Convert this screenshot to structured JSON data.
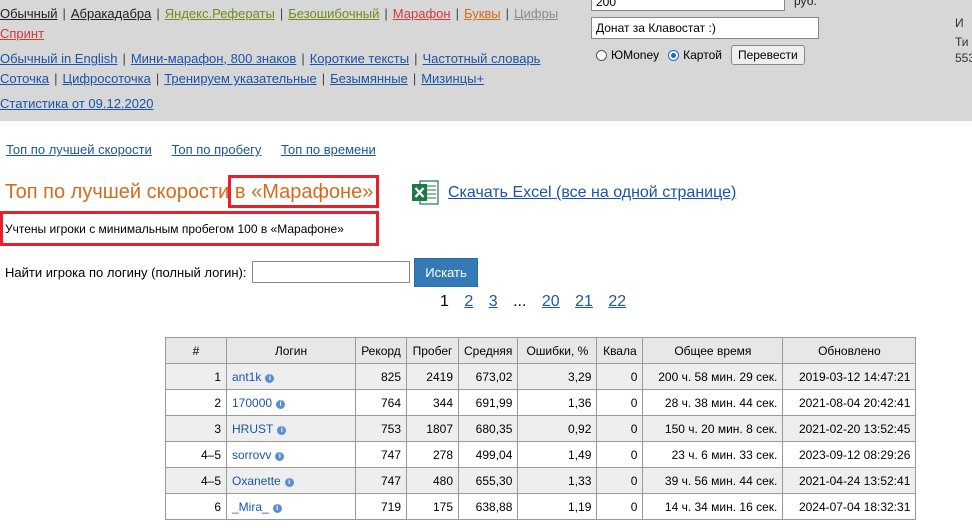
{
  "header": {
    "nav_row1": [
      {
        "label": "Обычный",
        "color": "gray"
      },
      {
        "label": "Абракадабра",
        "color": "gray"
      },
      {
        "label": "Яндекс.Рефераты",
        "color": "green"
      },
      {
        "label": "Безошибочный",
        "color": "green"
      },
      {
        "label": "Марафон",
        "color": "red"
      },
      {
        "label": "Буквы",
        "color": "orange"
      },
      {
        "label": "Цифры",
        "color": "lightgray"
      }
    ],
    "nav_row1b": [
      {
        "label": "Спринт",
        "color": "red"
      }
    ],
    "nav_row2": [
      {
        "label": "Обычный in English",
        "color": "blue"
      },
      {
        "label": "Мини-марафон, 800 знаков",
        "color": "blue"
      },
      {
        "label": "Короткие тексты",
        "color": "blue"
      },
      {
        "label": "Частотный словарь",
        "color": "blue"
      }
    ],
    "nav_row3": [
      {
        "label": "Соточка",
        "color": "blue"
      },
      {
        "label": "Цифросоточка",
        "color": "blue"
      },
      {
        "label": "Тренируем указательные",
        "color": "blue"
      },
      {
        "label": "Безымянные",
        "color": "blue"
      },
      {
        "label": "Мизинцы+",
        "color": "blue"
      }
    ],
    "nav_row4": [
      {
        "label": "Статистика от 09.12.2020",
        "color": "blue"
      }
    ],
    "donate": {
      "amount": "200",
      "currency": "руб.",
      "message": "Донат за Клавостат :)",
      "option1": "ЮMoney",
      "option2": "Картой",
      "submit": "Перевести"
    },
    "side_text": [
      "И",
      "Ти",
      "553"
    ]
  },
  "tabs": [
    "Топ по лучшей скорости",
    "Топ по пробегу",
    "Топ по времени"
  ],
  "title_main": "Топ по лучшей скорости ",
  "title_mode": "в «Марафоне»",
  "excel_link": "Скачать Excel (все на одной странице)",
  "note": "Учтены игроки с минимальным пробегом 100 в «Марафоне»",
  "search": {
    "label": "Найти игрока по логину (полный логин):",
    "value": "",
    "button": "Искать"
  },
  "pager": {
    "current": "1",
    "pages": [
      "2",
      "3"
    ],
    "ellipsis": "...",
    "last_pages": [
      "20",
      "21",
      "22"
    ]
  },
  "table": {
    "headers": [
      "#",
      "Логин",
      "Рекорд",
      "Пробег",
      "Средняя",
      "Ошибки, %",
      "Квала",
      "Общее время",
      "Обновлено"
    ],
    "rows": [
      [
        "1",
        "ant1k",
        "825",
        "2419",
        "673,02",
        "3,29",
        "0",
        "200 ч. 58 мин. 29 сек.",
        "2019-03-12 14:47:21"
      ],
      [
        "2",
        "170000",
        "764",
        "344",
        "691,99",
        "1,36",
        "0",
        "28 ч. 38 мин. 44 сек.",
        "2021-08-04 20:42:41"
      ],
      [
        "3",
        "HRUST",
        "753",
        "1807",
        "680,35",
        "0,92",
        "0",
        "150 ч. 20 мин. 8 сек.",
        "2021-02-20 13:52:45"
      ],
      [
        "4–5",
        "sorrovv",
        "747",
        "278",
        "499,04",
        "1,49",
        "0",
        "23 ч. 6 мин. 33 сек.",
        "2023-09-12 08:29:26"
      ],
      [
        "4–5",
        "Oxanette",
        "747",
        "480",
        "655,30",
        "1,33",
        "0",
        "39 ч. 56 мин. 44 сек.",
        "2021-04-24 13:52:41"
      ],
      [
        "6",
        "_Mira_",
        "719",
        "175",
        "638,88",
        "1,19",
        "0",
        "14 ч. 34 мин. 16 сек.",
        "2024-07-04 18:32:31"
      ]
    ]
  },
  "colors": {
    "accent_orange": "#d76a1a",
    "link_blue": "#1b54a8",
    "highlight_red": "#e8202a",
    "button_blue": "#337ab7"
  }
}
